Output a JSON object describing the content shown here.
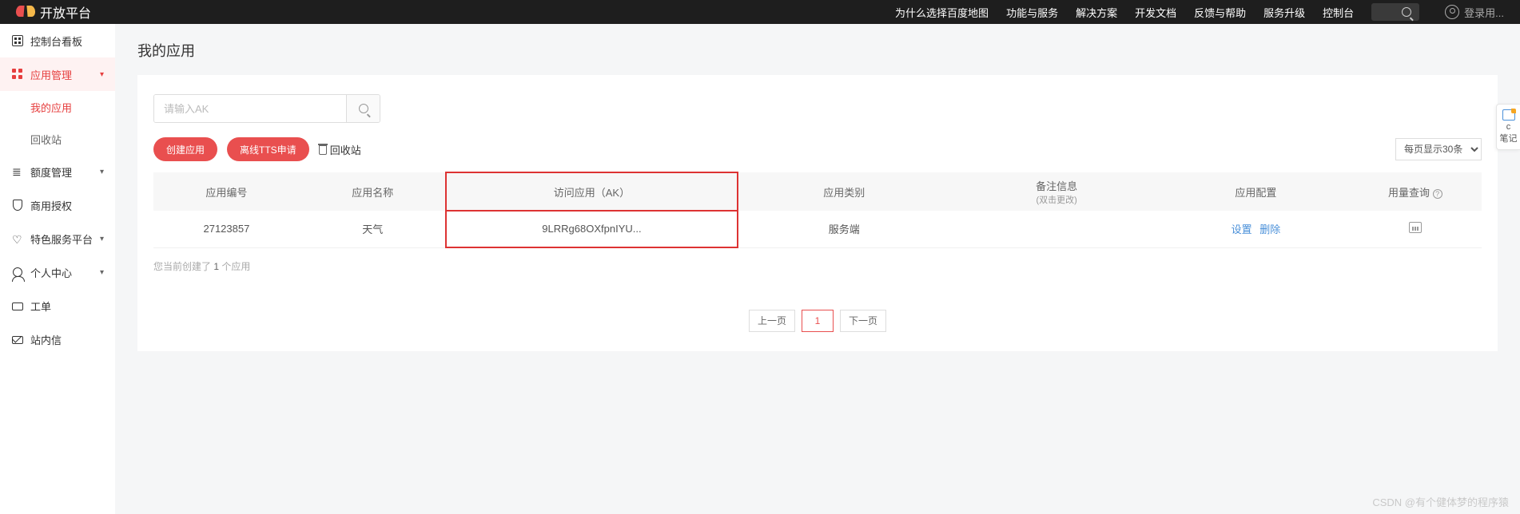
{
  "header": {
    "logo_text": "开放平台",
    "nav": [
      "为什么选择百度地图",
      "功能与服务",
      "解决方案",
      "开发文档",
      "反馈与帮助",
      "服务升级",
      "控制台"
    ],
    "user": "登录用..."
  },
  "sidebar": {
    "items": [
      {
        "label": "控制台看板",
        "icon": "dashboard",
        "expandable": false
      },
      {
        "label": "应用管理",
        "icon": "apps",
        "expandable": true,
        "active": true,
        "children": [
          {
            "label": "我的应用",
            "current": true
          },
          {
            "label": "回收站",
            "current": false
          }
        ]
      },
      {
        "label": "额度管理",
        "icon": "quota",
        "expandable": true
      },
      {
        "label": "商用授权",
        "icon": "license",
        "expandable": false
      },
      {
        "label": "特色服务平台",
        "icon": "feature",
        "expandable": true
      },
      {
        "label": "个人中心",
        "icon": "user",
        "expandable": true
      },
      {
        "label": "工单",
        "icon": "ticket",
        "expandable": false
      },
      {
        "label": "站内信",
        "icon": "mail",
        "expandable": false
      }
    ]
  },
  "main": {
    "title": "我的应用",
    "search_placeholder": "请输入AK",
    "btn_create": "创建应用",
    "btn_tts": "离线TTS申请",
    "btn_recycle": "回收站",
    "page_size_label": "每页显示30条",
    "table": {
      "headers": {
        "id": "应用编号",
        "name": "应用名称",
        "ak": "访问应用（AK）",
        "type": "应用类别",
        "remark": "备注信息",
        "remark_sub": "(双击更改)",
        "config": "应用配置",
        "usage": "用量查询"
      },
      "rows": [
        {
          "id": "27123857",
          "name": "天气",
          "ak": "9LRRg68OXfpnIYU...",
          "type": "服务端",
          "remark": "",
          "config_set": "设置",
          "config_del": "删除"
        }
      ]
    },
    "summary_prefix": "您当前创建了 ",
    "summary_count": "1",
    "summary_suffix": " 个应用",
    "pagination": {
      "prev": "上一页",
      "pages": [
        "1"
      ],
      "next": "下一页"
    }
  },
  "float_note": {
    "letter": "c",
    "label": "笔记"
  },
  "watermark": "CSDN @有个健体梦的程序猿"
}
